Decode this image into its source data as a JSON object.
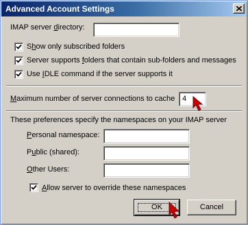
{
  "window": {
    "title": "Advanced Account Settings"
  },
  "imap": {
    "server_directory_label_pre": "IMAP server ",
    "server_directory_label_key": "d",
    "server_directory_label_post": "irectory:",
    "server_directory_value": ""
  },
  "options": {
    "show_subscribed_pre": "S",
    "show_subscribed_key": "h",
    "show_subscribed_post": "ow only subscribed folders",
    "show_subscribed_checked": true,
    "supports_subfolders_pre": "Server supports ",
    "supports_subfolders_key": "f",
    "supports_subfolders_post": "olders that contain sub-folders and messages",
    "supports_subfolders_checked": true,
    "idle_pre": "Use ",
    "idle_key": "I",
    "idle_post": "DLE command if the server supports it",
    "idle_checked": true
  },
  "connections": {
    "label_pre": "",
    "label_key": "M",
    "label_post": "aximum number of server connections to cache",
    "value": "4"
  },
  "namespaces": {
    "intro": "These preferences specify the namespaces on your IMAP server",
    "personal_pre": "",
    "personal_key": "P",
    "personal_post": "ersonal namespace:",
    "personal_value": "",
    "public_pre": "P",
    "public_key": "u",
    "public_post": "blic (shared):",
    "public_value": "",
    "other_pre": "",
    "other_key": "O",
    "other_post": "ther Users:",
    "other_value": "",
    "override_pre": "",
    "override_key": "A",
    "override_post": "llow server to override these namespaces",
    "override_checked": true
  },
  "buttons": {
    "ok": "OK",
    "cancel": "Cancel"
  },
  "icons": {
    "close": "close-icon",
    "checkmark": "checkmark-icon",
    "pointer": "pointer-arrow-icon"
  },
  "colors": {
    "title_start": "#0a246a",
    "title_end": "#a6caf0",
    "dialog_face": "#d4d0c8",
    "annotation_arrow": "#cc0000"
  }
}
